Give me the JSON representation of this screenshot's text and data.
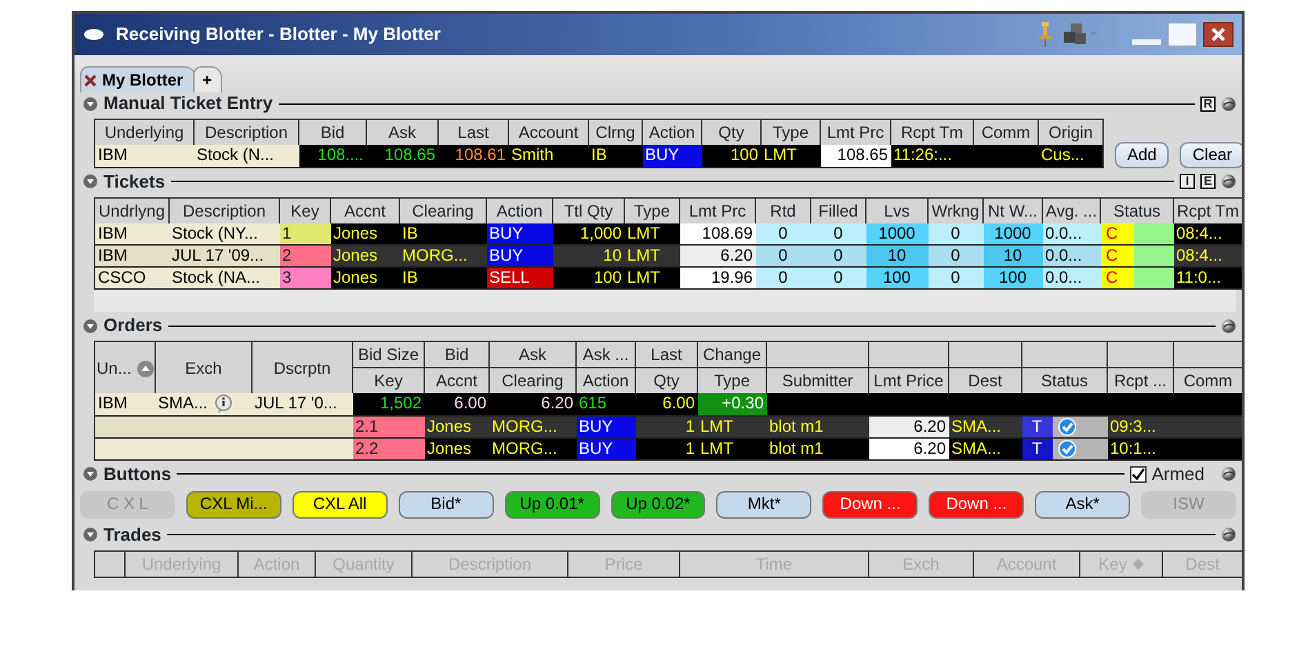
{
  "window": {
    "title": "Receiving Blotter - Blotter - My Blotter"
  },
  "tabs": [
    {
      "label": "My Blotter",
      "selected": true
    },
    {
      "label": "+",
      "selected": false
    }
  ],
  "manual_ticket_entry": {
    "title": "Manual Ticket Entry",
    "tools": [
      "R"
    ],
    "columns": [
      {
        "label": "Underlying",
        "kind": "ref"
      },
      {
        "label": "Description",
        "kind": "ref"
      },
      {
        "label": "Bid",
        "kind": "up"
      },
      {
        "label": "Ask",
        "kind": "up"
      },
      {
        "label": "Last",
        "kind": "last"
      },
      {
        "label": "Account",
        "kind": "info"
      },
      {
        "label": "Clrng",
        "kind": "info"
      },
      {
        "label": "Action",
        "kind": "action"
      },
      {
        "label": "Qty",
        "kind": "num"
      },
      {
        "label": "Type",
        "kind": "info"
      },
      {
        "label": "Lmt Prc",
        "kind": "edit"
      },
      {
        "label": "Rcpt Tm",
        "kind": "info"
      },
      {
        "label": "Comm",
        "kind": "info"
      },
      {
        "label": "Origin",
        "kind": "info"
      }
    ],
    "rows": [
      {
        "cells": [
          "IBM",
          "Stock (N...",
          "108....",
          "108.65",
          "108.61",
          "Smith",
          "IB",
          "BUY",
          "100",
          "LMT",
          "108.65",
          "11:26:...",
          null,
          "Cus..."
        ],
        "kind": "buy",
        "selected": false
      }
    ],
    "buttons": [
      "Add",
      "Clear"
    ]
  },
  "tickets": {
    "title": "Tickets",
    "tools": [
      "I",
      "E"
    ],
    "columns": [
      {
        "label": "Undrlyng",
        "kind": "ref"
      },
      {
        "label": "Description",
        "kind": "ref"
      },
      {
        "label": "Key",
        "kind": "key"
      },
      {
        "label": "Accnt",
        "kind": "info"
      },
      {
        "label": "Clearing",
        "kind": "info"
      },
      {
        "label": "Action",
        "kind": "action"
      },
      {
        "label": "Ttl Qty",
        "kind": "num"
      },
      {
        "label": "Type",
        "kind": "info"
      },
      {
        "label": "Lmt Prc",
        "kind": "edit"
      },
      {
        "label": "Rtd",
        "kind": "fill"
      },
      {
        "label": "Filled",
        "kind": "fill"
      },
      {
        "label": "Lvs",
        "kind": "fill2"
      },
      {
        "label": "Wrkng",
        "kind": "fill"
      },
      {
        "label": "Nt W...",
        "kind": "fill2"
      },
      {
        "label": "Avg. ...",
        "kind": "avg"
      },
      {
        "label": "Status",
        "kind": "status-c"
      },
      {
        "label": "Rcpt Tm",
        "kind": "info"
      }
    ],
    "rows": [
      {
        "cells": [
          "IBM",
          "Stock (NY...",
          "1",
          "Jones",
          "IB",
          "BUY",
          "1,000",
          "LMT",
          "108.69",
          "0",
          "0",
          "1000",
          "0",
          "1000",
          "0.0...",
          "C",
          "08:4..."
        ],
        "color": "#e0e870",
        "kind": "buy",
        "selected": false
      },
      {
        "cells": [
          "IBM",
          "JUL 17 '09...",
          "2",
          "Jones",
          "MORG...",
          "BUY",
          "10",
          "LMT",
          "6.20",
          "0",
          "0",
          "10",
          "0",
          "10",
          "0.0...",
          "C",
          "08:4..."
        ],
        "color": "#ff6f87",
        "kind": "buy",
        "selected": true
      },
      {
        "cells": [
          "CSCO",
          "Stock (NA...",
          "3",
          "Jones",
          "IB",
          "SELL",
          "100",
          "LMT",
          "19.96",
          "0",
          "0",
          "100",
          "0",
          "100",
          "0.0...",
          "C",
          "11:0..."
        ],
        "color": "#ff80c0",
        "kind": "sell",
        "selected": false
      }
    ]
  },
  "orders": {
    "title": "Orders",
    "columns": [
      {
        "label": "Un...",
        "kind": "ref"
      },
      {
        "label": "Exch",
        "kind": "ref"
      },
      {
        "label": "Dscrptn",
        "kind": "ref"
      },
      {
        "top": "Bid Size",
        "label": "Key",
        "kind": "key"
      },
      {
        "top": "Bid",
        "label": "Accnt",
        "kind": "info"
      },
      {
        "top": "Ask",
        "label": "Clearing",
        "kind": "info"
      },
      {
        "top": "Ask ...",
        "label": "Action",
        "kind": "action"
      },
      {
        "top": "Last",
        "label": "Qty",
        "kind": "num"
      },
      {
        "top": "Change",
        "label": "Type",
        "kind": "info"
      },
      {
        "label": "Submitter",
        "kind": "info"
      },
      {
        "label": "Lmt Price",
        "kind": "edit"
      },
      {
        "label": "Dest",
        "kind": "info"
      },
      {
        "label": "Status",
        "kind": "status-t"
      },
      {
        "label": "Rcpt ...",
        "kind": "info"
      },
      {
        "label": "Comm",
        "kind": "info"
      }
    ],
    "rows": [
      {
        "cells": [
          "IBM",
          {
            "text": "SMA...",
            "kind": "ref-info"
          },
          "JUL 17 '0...",
          {
            "text": "1,502",
            "kind": "up"
          },
          {
            "text": "6.00",
            "kind": "pale"
          },
          {
            "text": "6.20",
            "kind": "pale"
          },
          {
            "text": "615",
            "kind": "upl"
          },
          "6.00",
          {
            "text": "+0.30",
            "kind": "change"
          },
          {
            "kind": "dark"
          },
          {
            "kind": "dark"
          },
          {
            "kind": "dark"
          },
          {
            "kind": "dark"
          },
          {
            "kind": "dark"
          },
          {
            "kind": "dark"
          }
        ],
        "selected": false
      },
      {
        "cells": [
          null,
          null,
          null,
          "2.1",
          "Jones",
          "MORG...",
          "BUY",
          "1",
          "LMT",
          "blot  m1",
          "6.20",
          "SMA...",
          "T",
          "09:3...",
          null
        ],
        "color": "#ff6f87",
        "kind": "buy",
        "selected": true
      },
      {
        "cells": [
          null,
          null,
          null,
          "2.2",
          "Jones",
          "MORG...",
          "BUY",
          "1",
          "LMT",
          "blot  m1",
          "6.20",
          "SMA...",
          "T",
          "10:1...",
          null
        ],
        "color": "#ff6f87",
        "kind": "buy",
        "selected": false
      }
    ]
  },
  "buttons_panel": {
    "title": "Buttons",
    "armed": {
      "label": "Armed",
      "checked": true
    },
    "buttons": [
      {
        "label": "C X L",
        "color": "#c8c8c8",
        "disabled": true
      },
      {
        "label": "CXL Mi...",
        "color": "#b8b400",
        "disabled": false
      },
      {
        "label": "CXL All",
        "color": "#ffff00",
        "disabled": false
      },
      {
        "label": "Bid*",
        "color": "#c6d9ec",
        "disabled": false
      },
      {
        "label": "Up 0.01*",
        "color": "#1fb81f",
        "disabled": false
      },
      {
        "label": "Up 0.02*",
        "color": "#1fb81f",
        "disabled": false
      },
      {
        "label": "Mkt*",
        "color": "#c6d9ec",
        "disabled": false
      },
      {
        "label": "Down ...",
        "color": "#ff1414",
        "disabled": false
      },
      {
        "label": "Down ...",
        "color": "#ff1414",
        "disabled": false
      },
      {
        "label": "Ask*",
        "color": "#c6d9ec",
        "disabled": false
      },
      {
        "label": "ISW",
        "color": "#c8c8c8",
        "disabled": true
      }
    ]
  },
  "trades": {
    "title": "Trades",
    "columns": [
      null,
      "Underlying",
      "Action",
      "Quantity",
      "Description",
      "Price",
      "Time",
      "Exch",
      "Account",
      "Key",
      "Dest"
    ]
  }
}
